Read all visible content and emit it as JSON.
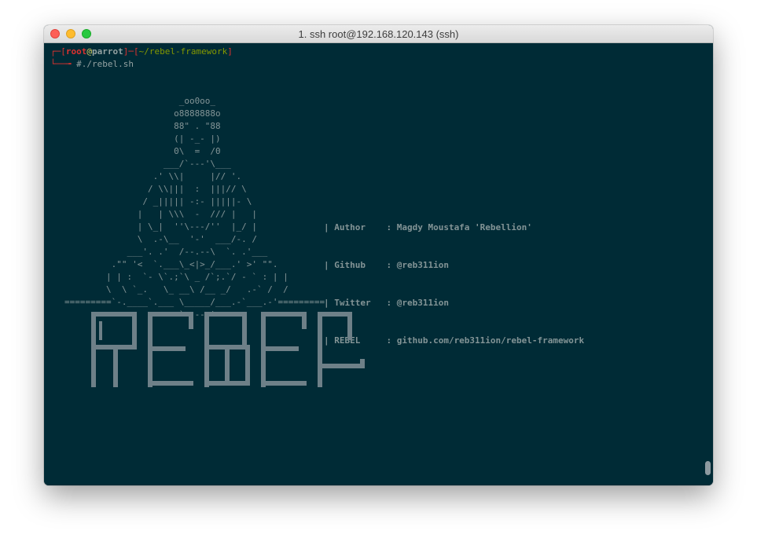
{
  "window": {
    "title": "1. ssh root@192.168.120.143 (ssh)"
  },
  "prompt": {
    "line1_prefix": "┌─[",
    "user": "root",
    "at": "@",
    "host": "parrot",
    "mid": "]─[",
    "path": "~/rebel-framework",
    "end": "]",
    "line2_prefix": "└──╼ ",
    "command": "#./rebel.sh"
  },
  "ascii_art": "                      _oo0oo_\n                     o8888888o\n                     88\" . \"88\n                     (| -_- |)\n                     0\\  =  /0\n                   ___/`---'\\___\n                 .' \\\\|     |// '.\n                / \\\\|||  :  |||// \\\n               / _||||| -:- |||||- \\\n              |   | \\\\\\  -  /// |   |\n              | \\_|  ''\\---/''  |_/ |\n              \\  .-\\__  '-'  ___/-. /\n            ___'. .'  /--.--\\  `. .'___\n         .\"\" '<  `.___\\_<|>_/___.' >' \"\".\n        | | :  `- \\`.;`\\ _ /`;.`/ - ` : | |\n        \\  \\ `_.   \\_ __\\ /__ _/   .-` /  /\n=========`-.____`.___ \\_____/___.-`___.-'=========\n                      `=---='",
  "info": {
    "author_label": "| Author    : Magdy Moustafa 'Rebellion'",
    "github_label": "| Github    : @reb311ion",
    "twitter_label": "| Twitter   : @reb311ion",
    "rebel_label": "| REBEL     : github.com/reb311ion/rebel-framework"
  },
  "banner": {
    "text": "REBEL",
    "color": "#6e8088"
  },
  "colors": {
    "background": "#002b36",
    "foreground": "#839496",
    "red": "#dc322f",
    "green": "#859900",
    "yellow": "#e0d562"
  }
}
